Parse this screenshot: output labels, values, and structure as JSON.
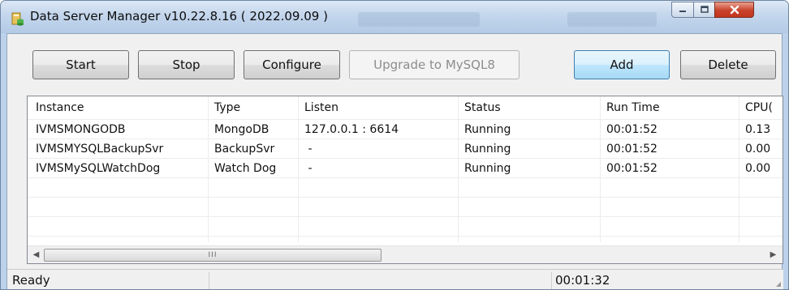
{
  "window": {
    "title": "Data Server Manager v10.22.8.16 ( 2022.09.09 )",
    "icon": "database-app-icon",
    "controls": [
      "minimize-icon",
      "maximize-icon",
      "close-icon"
    ]
  },
  "toolbar": {
    "start_label": "Start",
    "stop_label": "Stop",
    "configure_label": "Configure",
    "upgrade_label": "Upgrade to MySQL8",
    "add_label": "Add",
    "delete_label": "Delete"
  },
  "table": {
    "columns": [
      "Instance",
      "Type",
      "Listen",
      "Status",
      "Run Time",
      "CPU("
    ],
    "rows": [
      [
        "IVMSMONGODB",
        "MongoDB",
        "127.0.0.1 : 6614",
        "Running",
        "00:01:52",
        "0.13"
      ],
      [
        "IVMSMYSQLBackupSvr",
        "BackupSvr",
        " -",
        "Running",
        "00:01:52",
        "0.00"
      ],
      [
        "IVMSMySQLWatchDog",
        "Watch Dog",
        " -",
        "Running",
        "00:01:52",
        "0.00"
      ]
    ]
  },
  "scrollbar": {
    "left_arrow": "◀",
    "right_arrow": "▶",
    "grip": "III"
  },
  "statusbar": {
    "status_text": "Ready",
    "time_text": "00:01:32"
  },
  "colors": {
    "title_gradient_top": "#dce8f6",
    "close_button": "#c9422a",
    "focused_button": "#bee6fd"
  }
}
